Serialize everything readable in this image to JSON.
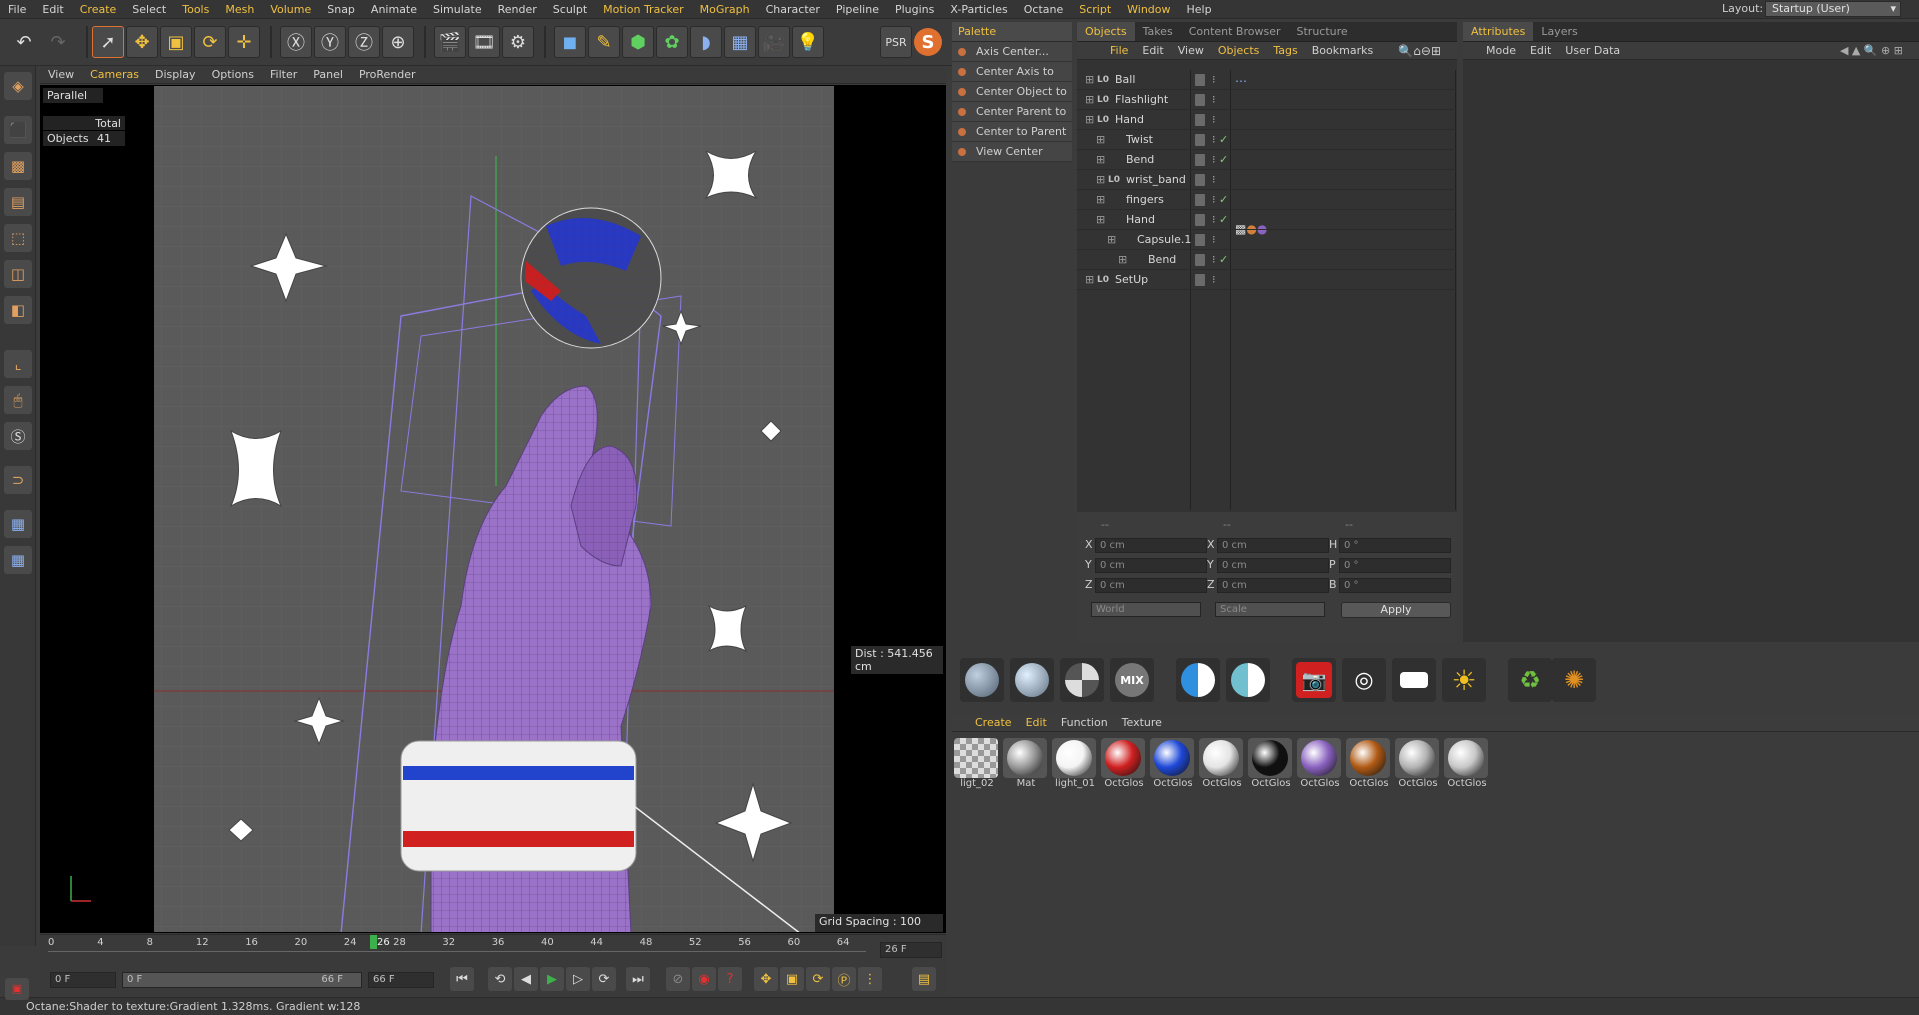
{
  "menu": [
    "File",
    "Edit",
    "Create",
    "Select",
    "Tools",
    "Mesh",
    "Volume",
    "Snap",
    "Animate",
    "Simulate",
    "Render",
    "Sculpt",
    "Motion Tracker",
    "MoGraph",
    "Character",
    "Pipeline",
    "Plugins",
    "X-Particles",
    "Octane",
    "Script",
    "Window",
    "Help"
  ],
  "menu_highlight": [
    "Create",
    "Tools",
    "Mesh",
    "Volume",
    "Motion Tracker",
    "MoGraph",
    "Script",
    "Window"
  ],
  "layout": {
    "label": "Layout:",
    "value": "Startup (User)"
  },
  "viewport": {
    "menu": [
      "View",
      "Cameras",
      "Display",
      "Options",
      "Filter",
      "Panel",
      "ProRender"
    ],
    "menu_highlight": "Cameras",
    "projection": "Parallel",
    "hud": {
      "total_label": "Total",
      "objects_label": "Objects",
      "objects_count": "41"
    },
    "dist": "Dist : 541.456 cm",
    "grid": "Grid Spacing : 100 cm"
  },
  "timeline": {
    "ticks": [
      "0",
      "4",
      "8",
      "12",
      "16",
      "20",
      "24",
      "28",
      "32",
      "36",
      "40",
      "44",
      "48",
      "52",
      "56",
      "60",
      "64"
    ],
    "current": "26",
    "end_field": "26 F"
  },
  "transport": {
    "start": "0 F",
    "range_start": "0 F",
    "range_end": "66 F",
    "end": "66 F"
  },
  "status": "Octane:Shader to texture:Gradient  1.328ms.  Gradient w:128",
  "palette": {
    "title": "Palette",
    "items": [
      "Axis Center...",
      "Center Axis to",
      "Center Object to",
      "Center Parent to",
      "Center to Parent",
      "View Center"
    ]
  },
  "objects": {
    "tabs": [
      "Objects",
      "Takes",
      "Content Browser",
      "Structure"
    ],
    "menu": [
      "File",
      "Edit",
      "View",
      "Objects",
      "Tags",
      "Bookmarks"
    ],
    "menu_highlight": [
      "File",
      "Objects",
      "Tags"
    ],
    "rows": [
      {
        "name": "Ball",
        "indent": 0,
        "check": false
      },
      {
        "name": "Flashlight",
        "indent": 0,
        "check": false
      },
      {
        "name": "Hand",
        "indent": 0,
        "check": false
      },
      {
        "name": "Twist",
        "indent": 1,
        "check": true
      },
      {
        "name": "Bend",
        "indent": 1,
        "check": true
      },
      {
        "name": "wrist_band",
        "indent": 1,
        "check": false
      },
      {
        "name": "fingers",
        "indent": 1,
        "check": true
      },
      {
        "name": "Hand",
        "indent": 1,
        "check": true
      },
      {
        "name": "Capsule.1",
        "indent": 2,
        "check": false
      },
      {
        "name": "Bend",
        "indent": 3,
        "check": true
      },
      {
        "name": "SetUp",
        "indent": 0,
        "check": false
      }
    ]
  },
  "coords": {
    "headers": [
      "--",
      "--",
      "--"
    ],
    "rows": [
      {
        "a": "X",
        "av": "0 cm",
        "b": "X",
        "bv": "0 cm",
        "c": "H",
        "cv": "0 °"
      },
      {
        "a": "Y",
        "av": "0 cm",
        "b": "Y",
        "bv": "0 cm",
        "c": "P",
        "cv": "0 °"
      },
      {
        "a": "Z",
        "av": "0 cm",
        "b": "Z",
        "bv": "0 cm",
        "c": "B",
        "cv": "0 °"
      }
    ],
    "mode": "World",
    "scale": "Scale",
    "apply": "Apply"
  },
  "attributes": {
    "tabs": [
      "Attributes",
      "Layers"
    ],
    "menu": [
      "Mode",
      "Edit",
      "User Data"
    ]
  },
  "materials": {
    "menu": [
      "Create",
      "Edit",
      "Function",
      "Texture"
    ],
    "menu_highlight": [
      "Create",
      "Edit"
    ],
    "items": [
      {
        "name": "ligt_02",
        "color": "#d8d8d8"
      },
      {
        "name": "Mat",
        "color": "#9a9a9a"
      },
      {
        "name": "light_01",
        "color": "#f4f4f4"
      },
      {
        "name": "OctGlos",
        "color": "#d02020"
      },
      {
        "name": "OctGlos",
        "color": "#1e48d8"
      },
      {
        "name": "OctGlos",
        "color": "#e4e4e4"
      },
      {
        "name": "OctGlos",
        "color": "#101010"
      },
      {
        "name": "OctGlos",
        "color": "#8a62c0"
      },
      {
        "name": "OctGlos",
        "color": "#b05a14"
      },
      {
        "name": "OctGlos",
        "color": "#b4b4b4"
      },
      {
        "name": "OctGlos",
        "color": "#c8c8c8"
      }
    ]
  }
}
